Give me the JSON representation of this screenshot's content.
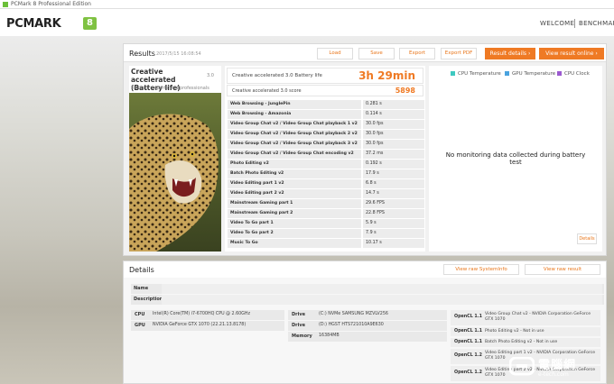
{
  "window": {
    "title": "PCMark 8 Professional Edition"
  },
  "nav": {
    "logo": "PCMARK",
    "logo_badge": "8",
    "welcome": "WELCOME",
    "benchmark": "BENCHMARK"
  },
  "results": {
    "title": "Results",
    "date": "2017/5/15 16:08:54",
    "buttons": {
      "load": "Load",
      "save": "Save",
      "export": "Export",
      "export_pdf": "Export PDF",
      "result_details": "Result details",
      "view_online": "View result online"
    },
    "test_name": "Creative accelerated (Battery life)",
    "test_version": "3.0",
    "test_subtitle": "Tests for experts and professionals",
    "battery_label": "Creative accelerated 3.0 Battery life",
    "battery_value": "3h 29min",
    "score_label": "Creative accelerated 3.0 score",
    "score_value": "5898",
    "subtests": [
      {
        "name": "Web Browsing - JunglePin",
        "value": "0.281 s"
      },
      {
        "name": "Web Browsing - Amazonia",
        "value": "0.114 s"
      },
      {
        "name": "Video Group Chat v2 / Video Group Chat playback 1 v2",
        "value": "30.0 fps"
      },
      {
        "name": "Video Group Chat v2 / Video Group Chat playback 2 v2",
        "value": "30.0 fps"
      },
      {
        "name": "Video Group Chat v2 / Video Group Chat playback 3 v2",
        "value": "30.0 fps"
      },
      {
        "name": "Video Group Chat v2 / Video Group Chat encoding v2",
        "value": "37.2 ms"
      },
      {
        "name": "Photo Editing v2",
        "value": "0.192 s"
      },
      {
        "name": "Batch Photo Editing v2",
        "value": "17.9 s"
      },
      {
        "name": "Video Editing part 1 v2",
        "value": "6.8 s"
      },
      {
        "name": "Video Editing part 2 v2",
        "value": "14.7 s"
      },
      {
        "name": "Mainstream Gaming part 1",
        "value": "29.6 FPS"
      },
      {
        "name": "Mainstream Gaming part 2",
        "value": "22.8 FPS"
      },
      {
        "name": "Video To Go part 1",
        "value": "5.9 s"
      },
      {
        "name": "Video To Go part 2",
        "value": "7.9 s"
      },
      {
        "name": "Music To Go",
        "value": "10.17 s"
      }
    ],
    "monitor_legend": [
      {
        "label": "CPU Temperature",
        "color": "#3ec9c0"
      },
      {
        "label": "GPU Temperature",
        "color": "#4aa3df"
      },
      {
        "label": "CPU Clock",
        "color": "#9b59d0"
      }
    ],
    "no_monitoring": "No monitoring data collected during battery test",
    "details_button": "Details"
  },
  "details": {
    "title": "Details",
    "view_raw_systeminfo": "View raw SystemInfo",
    "view_raw_result": "View raw result",
    "name_label": "Name",
    "description_label": "Description",
    "cpu_label": "CPU",
    "cpu_value": "Intel(R) Core(TM) i7-6700HQ CPU @ 2.60GHz",
    "gpu_label": "GPU",
    "gpu_value": "NVIDIA GeForce GTX 1070 (22.21.13.8178)",
    "drive_label": "Drive",
    "drive1_value": "(C:) NVMe SAMSUNG MZVLV256",
    "drive2_value": "(D:) HGST HTS721010A9E630",
    "memory_label": "Memory",
    "memory_value": "16384MB",
    "opencl": [
      {
        "label": "OpenCL 1.1",
        "value": "Video Group Chat v2 - NVIDIA Corporation GeForce GTX 1070"
      },
      {
        "label": "OpenCL 1.1",
        "value": "Photo Editing v2 - Not in use"
      },
      {
        "label": "OpenCL 1.1",
        "value": "Batch Photo Editing v2 - Not in use"
      },
      {
        "label": "OpenCL 1.2",
        "value": "Video Editing part 1 v2 - NVIDIA Corporation GeForce GTX 1070"
      },
      {
        "label": "OpenCL 1.2",
        "value": "Video Editing part 2 v2 - NVIDIA Corporation GeForce GTX 1070"
      }
    ]
  },
  "watermark": {
    "text": "電腦網",
    "url": "e-tech.com"
  }
}
